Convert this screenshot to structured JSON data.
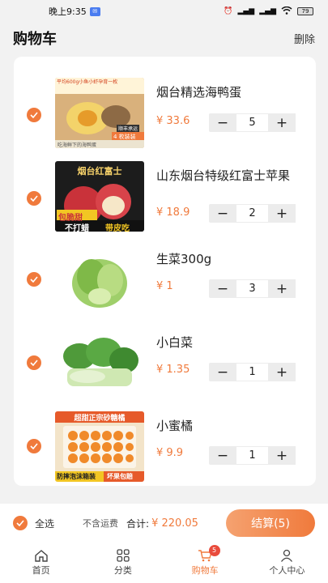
{
  "status_bar": {
    "time": "晚上9:35",
    "battery": "79"
  },
  "header": {
    "title": "购物车",
    "delete_label": "删除"
  },
  "cart": {
    "items": [
      {
        "name": "烟台精选海鸭蛋",
        "price": "¥ 33.6",
        "qty": "5",
        "thumb": {
          "banner": "平均600g小鱼小虾孕育一枚",
          "tag": "4 枚装装",
          "caption": "吃海鲜下的海鸭蛋",
          "ship": "顺丰承运"
        }
      },
      {
        "name": "山东烟台特级红富士苹果",
        "price": "¥ 18.9",
        "qty": "2",
        "thumb": {
          "banner": "烟台红富士",
          "tag1": "包脆甜",
          "tag2": "不打蜡",
          "tag3": "带皮吃"
        }
      },
      {
        "name": "生菜300g",
        "price": "¥ 1",
        "qty": "3",
        "thumb": {}
      },
      {
        "name": "小白菜",
        "price": "¥ 1.35",
        "qty": "1",
        "thumb": {}
      },
      {
        "name": "小蜜橘",
        "price": "¥ 9.9",
        "qty": "1",
        "thumb": {
          "banner": "超甜正宗砂糖橘",
          "tag1": "防摔泡沫箱装",
          "tag2": "坏果包赔"
        }
      }
    ]
  },
  "bottom": {
    "select_all": "全选",
    "shipping": "不含运费",
    "total_label": "合计:",
    "total_value": "¥ 220.05",
    "checkout": "结算(5)"
  },
  "tabs": [
    {
      "label": "首页",
      "icon": "home-icon"
    },
    {
      "label": "分类",
      "icon": "grid-icon"
    },
    {
      "label": "购物车",
      "icon": "cart-icon",
      "badge": "5"
    },
    {
      "label": "个人中心",
      "icon": "person-icon"
    }
  ],
  "colors": {
    "accent": "#f07a3c",
    "badge": "#e94b3c"
  }
}
